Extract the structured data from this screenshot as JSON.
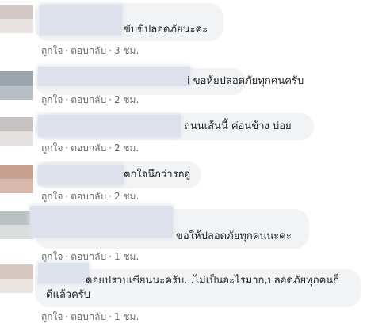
{
  "actions": {
    "like": "ถูกใจ",
    "dot": "·",
    "reply": "ตอบกลับ"
  },
  "comments": [
    {
      "text": "ขับขี่ปลอดภัยนะคะ",
      "time": "3 ชม."
    },
    {
      "text": "i ขอห้ยปลอดภัยทุกคนครับ",
      "time": "2 ชม."
    },
    {
      "text": "ถนนเส้นนี้ ค่อนข้าง บ่อย",
      "time": "2 ชม."
    },
    {
      "text": "ตกใจนึกว่ารถอู่",
      "time": "2 ชม."
    },
    {
      "text": "ขอให้ปลอดภัยทุกคนนะค่ะ",
      "time": "1 ชม."
    },
    {
      "text": "ดอยปราบเซียนนะครับ...ไม่เป็นอะไรมาก,ปลอดภัยทุกคนก็ดีแล้วครับ",
      "time": "1 ชม."
    }
  ],
  "colors": {
    "bubble": "#f2f3f5",
    "text": "#1c1e21",
    "meta": "#65676b",
    "redacted": "#dde1eb"
  }
}
